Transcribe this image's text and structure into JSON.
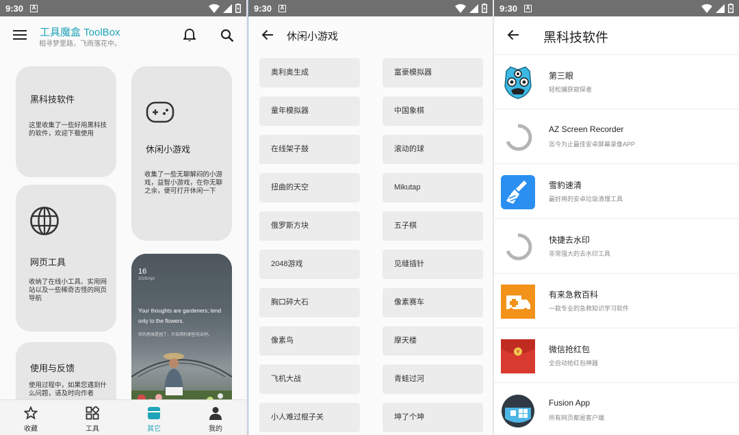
{
  "status": {
    "time": "9:30",
    "notif": "A"
  },
  "home": {
    "title": "工具魔盒 ToolBox",
    "subtitle": "相寻梦里路，飞雨落花中。",
    "cards": [
      {
        "title": "黑科技软件",
        "desc": "这里收集了一些好用黑科技的软件，欢迎下载使用"
      },
      {
        "title": "休闲小游戏",
        "desc": "收集了一些无聊解闷的小游戏，益智小游戏，在你无聊之余，便可打开休闲一下"
      },
      {
        "title": "网页工具",
        "desc": "收纳了在线小工具、实用网站以及一些稀奇古怪的网页导航"
      },
      {
        "title": "使用与反馈",
        "desc": "使用过程中，如果您遇到什么问题，请及时向作者"
      }
    ],
    "photo": {
      "day": "16",
      "month": "2026/Apr",
      "quote": "Your thoughts are gardeners; tend only to the flowers.",
      "quote_cn": "你的思绪是园丁，只去照料那些花朵吧。"
    },
    "nav": [
      {
        "label": "收藏",
        "icon": "star-icon"
      },
      {
        "label": "工具",
        "icon": "grid-icon"
      },
      {
        "label": "其它",
        "icon": "other-icon",
        "active": true
      },
      {
        "label": "我的",
        "icon": "person-icon"
      }
    ]
  },
  "games": {
    "title": "休闲小游戏",
    "items": [
      "奥利奥生成",
      "富豪模拟器",
      "童年模拟器",
      "中国象棋",
      "在线架子鼓",
      "滚动的球",
      "扭曲的天空",
      "Mikutap",
      "俄罗斯方块",
      "五子棋",
      "2048游戏",
      "见缝插针",
      "胸口碎大石",
      "像素赛车",
      "像素鸟",
      "摩天楼",
      "飞机大战",
      "青蛙过河",
      "小人难过棍子关",
      "坤了个坤"
    ]
  },
  "apps": {
    "title": "黑科技软件",
    "items": [
      {
        "name": "第三眼",
        "desc": "轻松捕获窥探者",
        "icon": "third-eye-icon"
      },
      {
        "name": "AZ Screen Recorder",
        "desc": "迄今为止最佳安卓屏幕录像APP",
        "icon": "loading-icon"
      },
      {
        "name": "雪豹速清",
        "desc": "最好用的安卓垃圾清理工具",
        "icon": "broom-icon"
      },
      {
        "name": "快捷去水印",
        "desc": "非常强大的去水印工具",
        "icon": "loading-icon"
      },
      {
        "name": "有来急救百科",
        "desc": "一款专业的急救知识学习软件",
        "icon": "ambulance-icon"
      },
      {
        "name": "微信抢红包",
        "desc": "全自动抢红包神器",
        "icon": "red-envelope-icon"
      },
      {
        "name": "Fusion App",
        "desc": "所有网页都是客户端",
        "icon": "fusion-app-icon"
      }
    ]
  }
}
